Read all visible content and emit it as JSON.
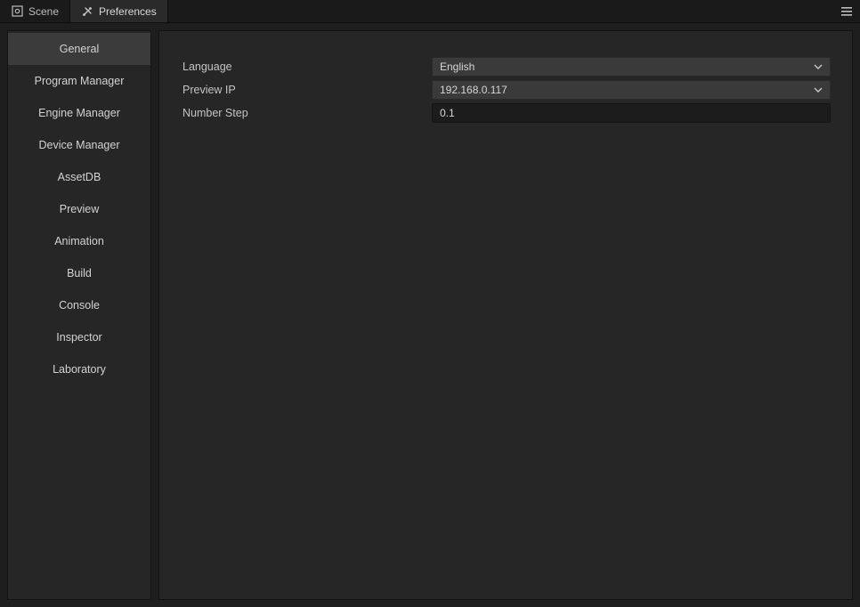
{
  "tabs": {
    "scene": {
      "label": "Scene"
    },
    "preferences": {
      "label": "Preferences"
    }
  },
  "sidebar": {
    "items": [
      {
        "label": "General"
      },
      {
        "label": "Program Manager"
      },
      {
        "label": "Engine Manager"
      },
      {
        "label": "Device Manager"
      },
      {
        "label": "AssetDB"
      },
      {
        "label": "Preview"
      },
      {
        "label": "Animation"
      },
      {
        "label": "Build"
      },
      {
        "label": "Console"
      },
      {
        "label": "Inspector"
      },
      {
        "label": "Laboratory"
      }
    ],
    "active_index": 0
  },
  "fields": {
    "language": {
      "label": "Language",
      "value": "English"
    },
    "preview_ip": {
      "label": "Preview IP",
      "value": "192.168.0.117"
    },
    "number_step": {
      "label": "Number Step",
      "value": "0.1"
    }
  }
}
